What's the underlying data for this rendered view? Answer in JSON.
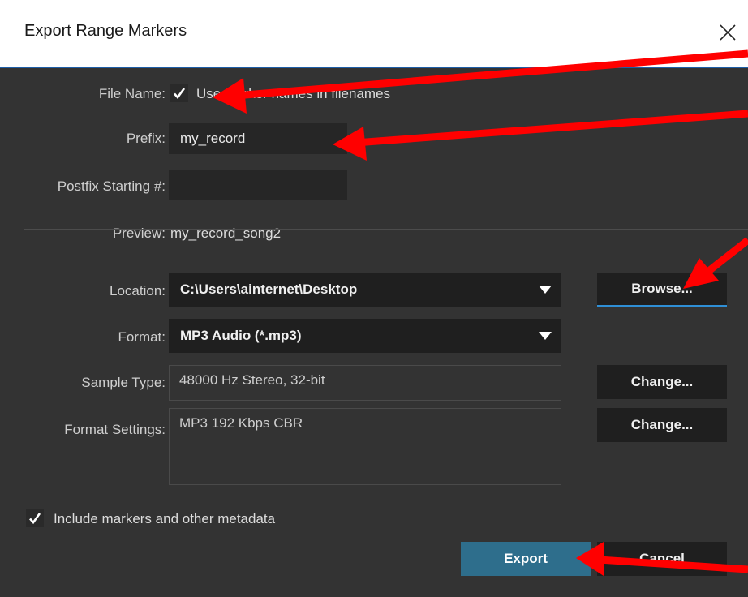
{
  "window": {
    "title": "Export Range Markers"
  },
  "file_name": {
    "label": "File Name:",
    "checkbox_text": "Use marker names in filenames",
    "checked": true
  },
  "prefix": {
    "label": "Prefix:",
    "value": "my_record"
  },
  "postfix": {
    "label": "Postfix Starting #:",
    "value": ""
  },
  "preview": {
    "label": "Preview:",
    "value": "my_record_song2"
  },
  "location": {
    "label": "Location:",
    "value": "C:\\Users\\ainternet\\Desktop",
    "browse_label": "Browse..."
  },
  "format": {
    "label": "Format:",
    "value": "MP3 Audio (*.mp3)"
  },
  "sample_type": {
    "label": "Sample Type:",
    "value": "48000 Hz Stereo, 32-bit",
    "change_label": "Change..."
  },
  "format_settings": {
    "label": "Format Settings:",
    "value": "MP3 192 Kbps CBR",
    "change_label": "Change..."
  },
  "metadata": {
    "label": "Include markers and other metadata",
    "checked": true
  },
  "actions": {
    "export_label": "Export",
    "cancel_label": "Cancel"
  },
  "colors": {
    "annotation_arrow": "#ff0000",
    "primary_button": "#2e6e8c",
    "dialog_bg": "#333333"
  }
}
